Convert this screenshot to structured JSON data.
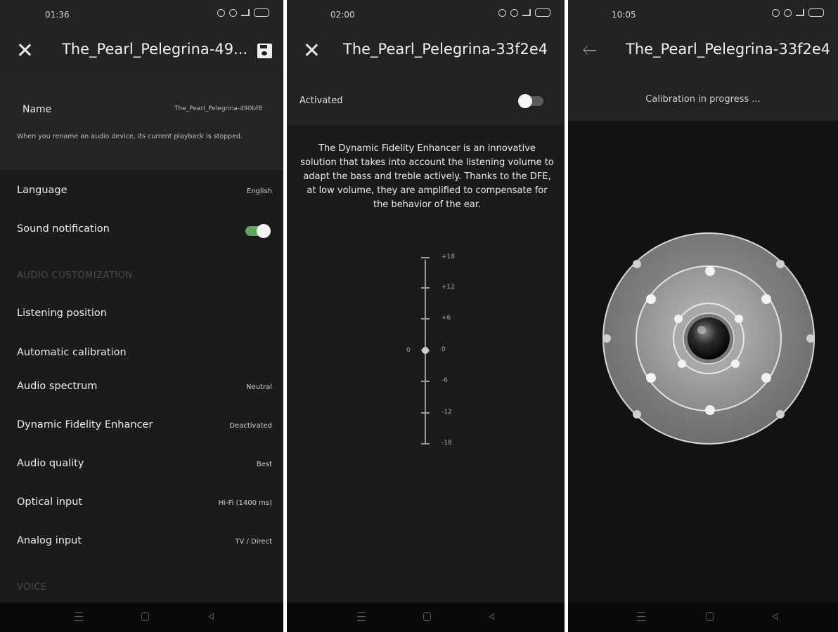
{
  "panel1": {
    "status": {
      "time": "01:36"
    },
    "title": "The_Pearl_Pelegrina-49...",
    "name": {
      "label": "Name",
      "value": "The_Pearl_Pelegrina-490bf8",
      "note": "When you rename an audio device, its current playback is stopped."
    },
    "rows": [
      {
        "label": "Language",
        "value": "English"
      },
      {
        "label": "Sound notification",
        "value": ""
      },
      {
        "label": "Listening position",
        "value": ""
      },
      {
        "label": "Automatic calibration",
        "value": ""
      },
      {
        "label": "Audio spectrum",
        "value": "Neutral"
      },
      {
        "label": "Dynamic Fidelity Enhancer",
        "value": "Deactivated"
      },
      {
        "label": "Audio quality",
        "value": "Best"
      },
      {
        "label": "Optical input",
        "value": "Hi-Fi (1400 ms)"
      },
      {
        "label": "Analog input",
        "value": "TV / Direct"
      }
    ],
    "sections": {
      "audio": "AUDIO CUSTOMIZATION",
      "voice": "VOICE"
    },
    "sound_notification_on": true
  },
  "panel2": {
    "status": {
      "time": "02:00"
    },
    "title": "The_Pearl_Pelegrina-33f2e4",
    "activated_label": "Activated",
    "activated_on": false,
    "description": "The Dynamic Fidelity Enhancer is an innovative solution that takes into account the listening volume to adapt the bass and treble actively. Thanks to the DFE, at low volume, they are amplified to compensate for the behavior of the ear.",
    "scale_labels": [
      "+18",
      "+12",
      "+6",
      "0",
      "-6",
      "-12",
      "-18"
    ],
    "current_value": "0"
  },
  "panel3": {
    "status": {
      "time": "10:05"
    },
    "title": "The_Pearl_Pelegrina-33f2e4",
    "calibration_text": "Calibration in progress ..."
  },
  "colors": {
    "background": "#1b1b1b",
    "header": "#232323",
    "toggle_on": "#5da85d",
    "toggle_off": "#5a5a5a"
  },
  "icons": [
    "close-icon",
    "save-icon",
    "back-arrow-icon",
    "nav-menu-icon",
    "nav-home-icon",
    "nav-back-icon"
  ]
}
